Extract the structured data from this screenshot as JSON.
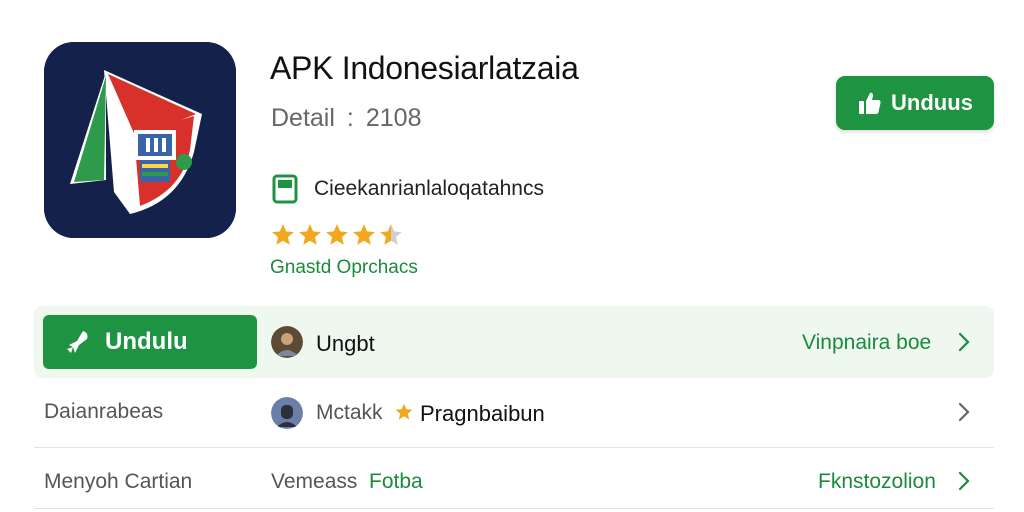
{
  "app": {
    "title": "APK Indonesiarlatzaia",
    "detail_label": "Detail",
    "detail_sep": ":",
    "detail_value": "2108",
    "category": "Cieekanrianlaloqatahncs",
    "publisher": "Gnastd Oprchacs",
    "rating": 4.5,
    "download_label": "Unduus"
  },
  "rows": [
    {
      "button_label": "Undulu",
      "center_text": "Ungbt",
      "right_link": "Vinpnaira boe"
    },
    {
      "left_label": "Daianrabeas",
      "center_text_a": "Mctakk",
      "center_text_b": "Pragnbaibun"
    },
    {
      "left_label": "Menyoh Cartian",
      "center_text_a": "Vemeass",
      "center_text_b": "Fotba",
      "right_link": "Fknstozolion"
    }
  ],
  "colors": {
    "primary_green": "#1e9442",
    "link_green": "#1c8a3c",
    "icon_bg": "#14214a",
    "star": "#f2a81d",
    "row_highlight": "#eff8ef"
  },
  "icons": [
    "app-logo-icon",
    "book-icon",
    "star-icon",
    "thumbs-up-icon",
    "rocket-icon",
    "avatar-icon",
    "chevron-right-icon"
  ]
}
